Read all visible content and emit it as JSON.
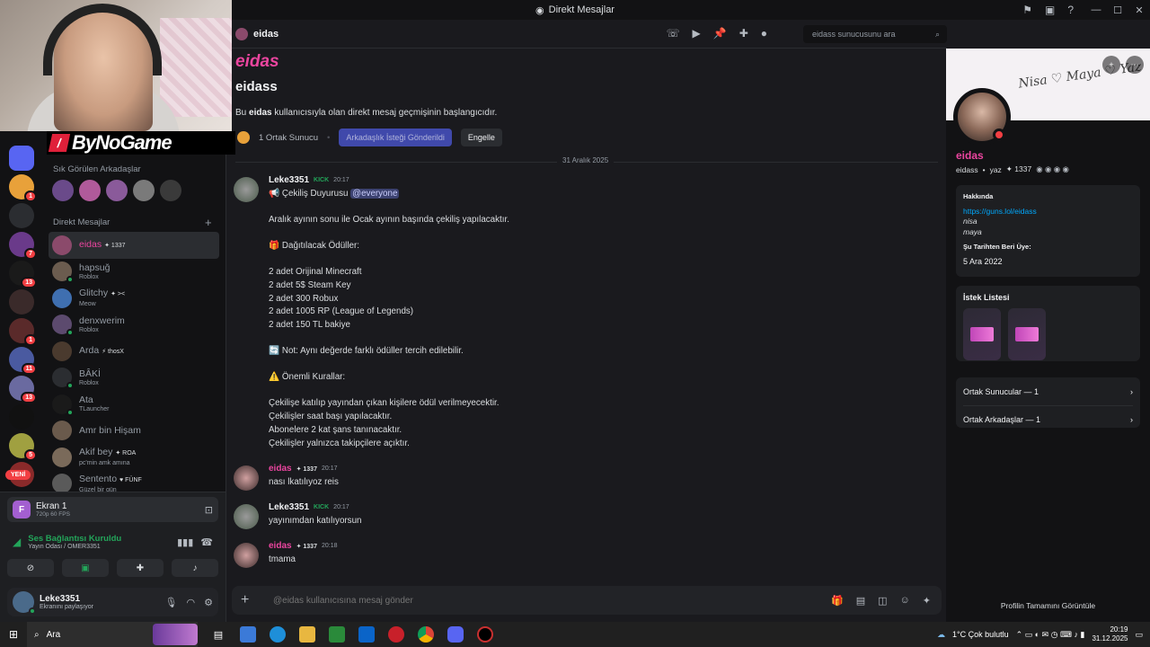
{
  "window": {
    "title": "Direkt Mesajlar"
  },
  "brand": {
    "logo_text": "ByNoGame"
  },
  "sidebar": {
    "frequent_title": "Sık Görülen Arkadaşlar",
    "dm_title": "Direkt Mesajlar",
    "dms": [
      {
        "name": "eidas",
        "tag": "✦ 1337",
        "sub": "",
        "color": "#8b4a6b"
      },
      {
        "name": "hapsuğ",
        "tag": "",
        "sub": "Roblox",
        "color": "#6b5c4f"
      },
      {
        "name": "Glitchy",
        "tag": "✦ ><",
        "sub": "Meow",
        "color": "#3f6fb0"
      },
      {
        "name": "denxwerim",
        "tag": "",
        "sub": "Roblox",
        "color": "#5c4a6e"
      },
      {
        "name": "Arda",
        "tag": "⚡ thosX",
        "sub": "",
        "color": "#4a3a2e"
      },
      {
        "name": "BÂKİ",
        "tag": "",
        "sub": "Roblox",
        "color": "#2b2d31"
      },
      {
        "name": "Ata",
        "tag": "",
        "sub": "TLauncher",
        "color": "#1a1a1a"
      },
      {
        "name": "Amr bin Hişam",
        "tag": "",
        "sub": "",
        "color": "#6a5a4c"
      },
      {
        "name": "Akif bey",
        "tag": "✦ ROA",
        "sub": "pc'min amk amına",
        "color": "#7a6a5a"
      },
      {
        "name": "Sentento",
        "tag": "♥ FÜNF",
        "sub": "Güzel bir gün",
        "color": "#5a5a5a"
      }
    ],
    "new_label": "YENİ"
  },
  "panel": {
    "screen_title": "Ekran 1",
    "screen_sub": "720p 60 FPS",
    "voice_status": "Ses Bağlantısı Kuruldu",
    "voice_channel": "Yayın Odası / OMER3351",
    "user_name": "Leke3351",
    "user_status": "Ekranını paylaşıyor"
  },
  "chat": {
    "header_name": "eidas",
    "search_placeholder": "eidass sunucusunu ara",
    "intro_title": "eidas",
    "intro_handle": "eidass",
    "intro_desc_pre": "Bu ",
    "intro_desc_name": "eidas",
    "intro_desc_post": " kullanıcısıyla olan direkt mesaj geçmişinin başlangıcıdır.",
    "mutual_servers": "1 Ortak Sunucu",
    "friend_request_btn": "Arkadaşlık İsteği Gönderildi",
    "block_btn": "Engelle",
    "date_separator": "31 Aralık 2025",
    "composer_placeholder": "@eidas kullanıcısına mesaj gönder"
  },
  "messages": {
    "m1": {
      "author": "Leke3351",
      "tag": "KICK",
      "time": "20:17",
      "lines": [
        "📢 Çekiliş Duyurusu",
        "@everyone",
        "Aralık ayının sonu ile Ocak ayının başında çekiliş yapılacaktır.",
        "🎁 Dağıtılacak Ödüller:",
        "2 adet Orijinal Minecraft",
        "2 adet 5$ Steam Key",
        "2 adet 300 Robux",
        "2 adet 1005 RP (League of Legends)",
        "2 adet 150 TL bakiye",
        "🔄 Not: Aynı değerde farklı ödüller tercih edilebilir.",
        "⚠️ Önemli Kurallar:",
        "Çekilişe katılıp yayından çıkan kişilere ödül verilmeyecektir.",
        "Çekilişler saat başı yapılacaktır.",
        "Abonelere 2 kat şans tanınacaktır.",
        "Çekilişler yalnızca takipçilere açıktır."
      ]
    },
    "m2": {
      "author": "eidas",
      "tag": "✦ 1337",
      "time": "20:17",
      "text": "nası lkatılıyoz reis"
    },
    "m3": {
      "author": "Leke3351",
      "tag": "KICK",
      "time": "20:17",
      "text": "yayınımdan katılıyorsun"
    },
    "m4": {
      "author": "eidas",
      "tag": "✦ 1337",
      "time": "20:18",
      "text": "tmama"
    }
  },
  "profile": {
    "banner_text": "Nisa ♡ Maya ♡ Yaz",
    "name": "eidas",
    "handle": "eidass",
    "pronoun": "yaz",
    "tag": "✦ 1337",
    "about_title": "Hakkında",
    "about_link": "https://guns.lol/eidass",
    "about_line1": "nisa",
    "about_line2": "maya",
    "member_since_title": "Şu Tarihten Beri Üye:",
    "member_since": "5 Ara 2022",
    "wishlist_title": "İstek Listesi",
    "mutual_servers": "Ortak Sunucular — 1",
    "mutual_friends": "Ortak Arkadaşlar — 1",
    "footer": "Profilin Tamamını Görüntüle"
  },
  "taskbar": {
    "search": "Ara",
    "weather": "1°C  Çok bulutlu",
    "time": "20:19",
    "date": "31.12.2025"
  },
  "colors": {
    "accent": "#5865f2",
    "pink": "#eb459f",
    "online": "#23a55a",
    "danger": "#f23f43"
  }
}
